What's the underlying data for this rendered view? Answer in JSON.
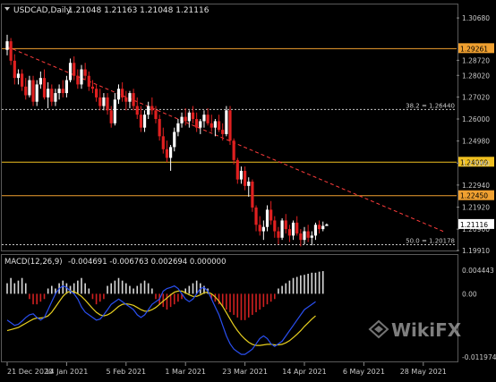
{
  "chart_data": {
    "type": "candlestick",
    "symbol": "USDCAD",
    "timeframe": "Daily",
    "header": {
      "symbol_tf": "USDCAD,Daily",
      "ohlc": "1.21048 1.21163 1.21048 1.21116"
    },
    "price_axis": {
      "min": 1.1991,
      "max": 1.306,
      "ticks": [
        "1.30680",
        "1.28720",
        "1.28020",
        "1.27020",
        "1.26000",
        "1.24980",
        "1.23960",
        "1.22940",
        "1.21920",
        "1.20900",
        "1.19910"
      ],
      "tick_values": [
        1.3068,
        1.2872,
        1.2802,
        1.2702,
        1.26,
        1.2498,
        1.2396,
        1.2294,
        1.2192,
        1.209,
        1.1991
      ]
    },
    "levels": [
      {
        "value": 1.29261,
        "label": "1.29261",
        "style": "solid",
        "color": "#f0a030"
      },
      {
        "value": 1.2644,
        "label": "38.2 = 1.26440",
        "style": "dashed",
        "color": "#c8c8c8",
        "tag": ""
      },
      {
        "value": 1.24,
        "label": "1.24000",
        "style": "solid",
        "color": "#f0c020"
      },
      {
        "value": 1.2245,
        "label": "1.22450",
        "style": "solid",
        "color": "#f0a030"
      },
      {
        "value": 1.20178,
        "label": "50.0 = 1.20178",
        "style": "dashed",
        "color": "#c8c8c8",
        "tag": ""
      }
    ],
    "current_price": {
      "value": 1.21116,
      "label": "1.21116"
    },
    "trendline": {
      "from": [
        0,
        1.2935
      ],
      "to": [
        118,
        1.2075
      ],
      "color": "#ff3c3c",
      "style": "dashed"
    },
    "candles": [
      [
        1.292,
        1.299,
        1.2895,
        1.296
      ],
      [
        1.296,
        1.2975,
        1.285,
        1.287
      ],
      [
        1.287,
        1.29,
        1.276,
        1.279
      ],
      [
        1.279,
        1.283,
        1.276,
        1.281
      ],
      [
        1.281,
        1.283,
        1.273,
        1.275
      ],
      [
        1.275,
        1.279,
        1.269,
        1.271
      ],
      [
        1.271,
        1.28,
        1.27,
        1.278
      ],
      [
        1.278,
        1.28,
        1.266,
        1.268
      ],
      [
        1.268,
        1.278,
        1.266,
        1.276
      ],
      [
        1.276,
        1.282,
        1.274,
        1.279
      ],
      [
        1.279,
        1.283,
        1.269,
        1.27
      ],
      [
        1.27,
        1.277,
        1.265,
        1.274
      ],
      [
        1.274,
        1.276,
        1.266,
        1.268
      ],
      [
        1.268,
        1.274,
        1.266,
        1.272
      ],
      [
        1.272,
        1.276,
        1.269,
        1.274
      ],
      [
        1.274,
        1.278,
        1.27,
        1.272
      ],
      [
        1.272,
        1.28,
        1.27,
        1.278
      ],
      [
        1.278,
        1.288,
        1.277,
        1.286
      ],
      [
        1.286,
        1.289,
        1.278,
        1.28
      ],
      [
        1.28,
        1.283,
        1.274,
        1.276
      ],
      [
        1.276,
        1.285,
        1.274,
        1.283
      ],
      [
        1.283,
        1.286,
        1.278,
        1.28
      ],
      [
        1.28,
        1.282,
        1.273,
        1.275
      ],
      [
        1.275,
        1.278,
        1.272,
        1.274
      ],
      [
        1.274,
        1.276,
        1.268,
        1.27
      ],
      [
        1.27,
        1.274,
        1.264,
        1.266
      ],
      [
        1.266,
        1.272,
        1.264,
        1.27
      ],
      [
        1.27,
        1.272,
        1.262,
        1.264
      ],
      [
        1.264,
        1.266,
        1.256,
        1.258
      ],
      [
        1.258,
        1.272,
        1.257,
        1.269
      ],
      [
        1.269,
        1.276,
        1.267,
        1.274
      ],
      [
        1.274,
        1.277,
        1.268,
        1.27
      ],
      [
        1.27,
        1.273,
        1.264,
        1.268
      ],
      [
        1.268,
        1.273,
        1.265,
        1.272
      ],
      [
        1.272,
        1.274,
        1.264,
        1.266
      ],
      [
        1.266,
        1.27,
        1.26,
        1.262
      ],
      [
        1.262,
        1.266,
        1.254,
        1.256
      ],
      [
        1.256,
        1.264,
        1.254,
        1.262
      ],
      [
        1.262,
        1.268,
        1.26,
        1.266
      ],
      [
        1.266,
        1.27,
        1.262,
        1.264
      ],
      [
        1.264,
        1.266,
        1.258,
        1.26
      ],
      [
        1.26,
        1.262,
        1.25,
        1.252
      ],
      [
        1.252,
        1.256,
        1.244,
        1.246
      ],
      [
        1.246,
        1.25,
        1.24,
        1.242
      ],
      [
        1.242,
        1.248,
        1.236,
        1.247
      ],
      [
        1.247,
        1.256,
        1.245,
        1.254
      ],
      [
        1.254,
        1.26,
        1.252,
        1.258
      ],
      [
        1.258,
        1.263,
        1.256,
        1.261
      ],
      [
        1.261,
        1.265,
        1.257,
        1.259
      ],
      [
        1.259,
        1.264,
        1.256,
        1.263
      ],
      [
        1.263,
        1.266,
        1.258,
        1.26
      ],
      [
        1.26,
        1.263,
        1.254,
        1.256
      ],
      [
        1.256,
        1.26,
        1.253,
        1.259
      ],
      [
        1.259,
        1.264,
        1.256,
        1.262
      ],
      [
        1.262,
        1.265,
        1.257,
        1.258
      ],
      [
        1.258,
        1.262,
        1.254,
        1.256
      ],
      [
        1.256,
        1.26,
        1.252,
        1.259
      ],
      [
        1.259,
        1.262,
        1.254,
        1.255
      ],
      [
        1.255,
        1.258,
        1.25,
        1.253
      ],
      [
        1.253,
        1.266,
        1.252,
        1.264
      ],
      [
        1.264,
        1.266,
        1.248,
        1.25
      ],
      [
        1.25,
        1.251,
        1.239,
        1.241
      ],
      [
        1.241,
        1.242,
        1.23,
        1.232
      ],
      [
        1.232,
        1.238,
        1.23,
        1.236
      ],
      [
        1.236,
        1.238,
        1.227,
        1.229
      ],
      [
        1.229,
        1.233,
        1.224,
        1.231
      ],
      [
        1.231,
        1.232,
        1.217,
        1.219
      ],
      [
        1.219,
        1.22,
        1.208,
        1.211
      ],
      [
        1.211,
        1.215,
        1.206,
        1.208
      ],
      [
        1.208,
        1.213,
        1.204,
        1.21
      ],
      [
        1.21,
        1.22,
        1.208,
        1.218
      ],
      [
        1.218,
        1.222,
        1.211,
        1.213
      ],
      [
        1.213,
        1.215,
        1.205,
        1.208
      ],
      [
        1.208,
        1.21,
        1.202,
        1.205
      ],
      [
        1.205,
        1.214,
        1.204,
        1.213
      ],
      [
        1.213,
        1.216,
        1.207,
        1.209
      ],
      [
        1.209,
        1.211,
        1.203,
        1.206
      ],
      [
        1.206,
        1.213,
        1.204,
        1.212
      ],
      [
        1.212,
        1.215,
        1.206,
        1.207
      ],
      [
        1.207,
        1.209,
        1.201,
        1.204
      ],
      [
        1.204,
        1.21,
        1.202,
        1.208
      ],
      [
        1.208,
        1.211,
        1.203,
        1.205
      ],
      [
        1.205,
        1.208,
        1.2015,
        1.206
      ],
      [
        1.206,
        1.212,
        1.204,
        1.211
      ],
      [
        1.211,
        1.213,
        1.207,
        1.209
      ],
      [
        1.209,
        1.2125,
        1.208,
        1.2105
      ],
      [
        1.21048,
        1.21163,
        1.21048,
        1.21116
      ]
    ],
    "macd": {
      "label": "MACD(12,26,9)",
      "values": "-0.004691 -0.006763 0.002694 0.000000",
      "axis_ticks": [
        "0.004443",
        "0.00",
        "-0.011974"
      ],
      "axis_tick_values": [
        0.004443,
        0.0,
        -0.011974
      ],
      "histogram": [
        0.002,
        0.003,
        0.002,
        0.0025,
        0.003,
        0.002,
        -0.001,
        -0.002,
        -0.002,
        -0.0015,
        -0.001,
        0.001,
        0.0015,
        0.001,
        0.002,
        0.0025,
        0.002,
        0.0015,
        0.002,
        0.0025,
        0.003,
        0.002,
        0.001,
        -0.001,
        -0.002,
        -0.0015,
        -0.001,
        0.0015,
        0.002,
        0.0025,
        0.003,
        0.0025,
        0.002,
        0.0015,
        0.001,
        0.0015,
        0.002,
        0.0025,
        0.002,
        0.001,
        -0.001,
        -0.002,
        -0.0025,
        -0.003,
        -0.0025,
        -0.002,
        -0.0015,
        -0.001,
        0.001,
        0.0015,
        0.002,
        0.0025,
        0.002,
        0.0015,
        0.001,
        -0.001,
        -0.0015,
        -0.002,
        -0.0025,
        -0.003,
        -0.0035,
        -0.004,
        -0.0045,
        -0.005,
        -0.005,
        -0.0045,
        -0.004,
        -0.0035,
        -0.003,
        -0.0025,
        -0.002,
        -0.0015,
        -0.001,
        0.001,
        0.0015,
        0.002,
        0.0025,
        0.003,
        0.0032,
        0.0035,
        0.0036,
        0.0038,
        0.004,
        0.004,
        0.0042,
        0.0043
      ],
      "macd_line": [
        -0.005,
        -0.0055,
        -0.006,
        -0.0058,
        -0.0052,
        -0.0045,
        -0.004,
        -0.0038,
        -0.0045,
        -0.005,
        -0.0045,
        -0.003,
        -0.0015,
        0.0,
        0.001,
        0.0015,
        0.0012,
        0.0005,
        0.0,
        -0.001,
        -0.0025,
        -0.0035,
        -0.004,
        -0.0045,
        -0.005,
        -0.0048,
        -0.004,
        -0.003,
        -0.002,
        -0.0015,
        -0.001,
        -0.0015,
        -0.002,
        -0.0025,
        -0.003,
        -0.004,
        -0.0045,
        -0.004,
        -0.003,
        -0.002,
        -0.0015,
        -0.001,
        0.0005,
        0.001,
        0.0012,
        0.0015,
        0.001,
        0.0,
        -0.001,
        -0.0015,
        -0.001,
        0.0,
        0.001,
        0.0012,
        0.0005,
        -0.001,
        -0.0025,
        -0.004,
        -0.006,
        -0.008,
        -0.0095,
        -0.0105,
        -0.011,
        -0.0115,
        -0.0115,
        -0.011,
        -0.0105,
        -0.0095,
        -0.0085,
        -0.008,
        -0.0085,
        -0.0095,
        -0.01,
        -0.0095,
        -0.009,
        -0.008,
        -0.007,
        -0.006,
        -0.005,
        -0.004,
        -0.003,
        -0.0025,
        -0.002,
        -0.0015
      ],
      "signal_line": [
        -0.007,
        -0.0068,
        -0.0066,
        -0.0064,
        -0.006,
        -0.0056,
        -0.0052,
        -0.0048,
        -0.0046,
        -0.0046,
        -0.0045,
        -0.0042,
        -0.0035,
        -0.0025,
        -0.0015,
        -0.0005,
        0.0002,
        0.0005,
        0.0004,
        0.0,
        -0.0005,
        -0.0012,
        -0.002,
        -0.0028,
        -0.0035,
        -0.004,
        -0.0042,
        -0.004,
        -0.0036,
        -0.003,
        -0.0024,
        -0.002,
        -0.0019,
        -0.002,
        -0.0022,
        -0.0026,
        -0.003,
        -0.0033,
        -0.0033,
        -0.003,
        -0.0026,
        -0.002,
        -0.0014,
        -0.0008,
        -0.0002,
        0.0003,
        0.0005,
        0.0005,
        0.0002,
        -0.0002,
        -0.0005,
        -0.0005,
        -0.0002,
        0.0002,
        0.0003,
        0.0,
        -0.0006,
        -0.0014,
        -0.0024,
        -0.0036,
        -0.0048,
        -0.006,
        -0.007,
        -0.0079,
        -0.0086,
        -0.0092,
        -0.0096,
        -0.0098,
        -0.0098,
        -0.0097,
        -0.0096,
        -0.0096,
        -0.0097,
        -0.0097,
        -0.0096,
        -0.0093,
        -0.0089,
        -0.0083,
        -0.0077,
        -0.007,
        -0.0062,
        -0.0055,
        -0.0048,
        -0.0042
      ],
      "macd_color": "#2a4ff0",
      "signal_color": "#e8d020",
      "hist_pos_color": "#d8d8d8",
      "hist_neg_color": "#d02020"
    },
    "date_labels": [
      "21 Dec 2020",
      "14 Jan 2021",
      "5 Feb 2021",
      "1 Mar 2021",
      "23 Mar 2021",
      "14 Apr 2021",
      "6 May 2021",
      "28 May 2021"
    ],
    "date_label_index": [
      0,
      16,
      32,
      48,
      64,
      80,
      96,
      112
    ],
    "colors": {
      "bull": "#ffffff",
      "bear": "#e02020",
      "grid": "#333333",
      "axis_text": "#c8c8c8"
    }
  },
  "watermark": {
    "text": "WikiFX"
  }
}
